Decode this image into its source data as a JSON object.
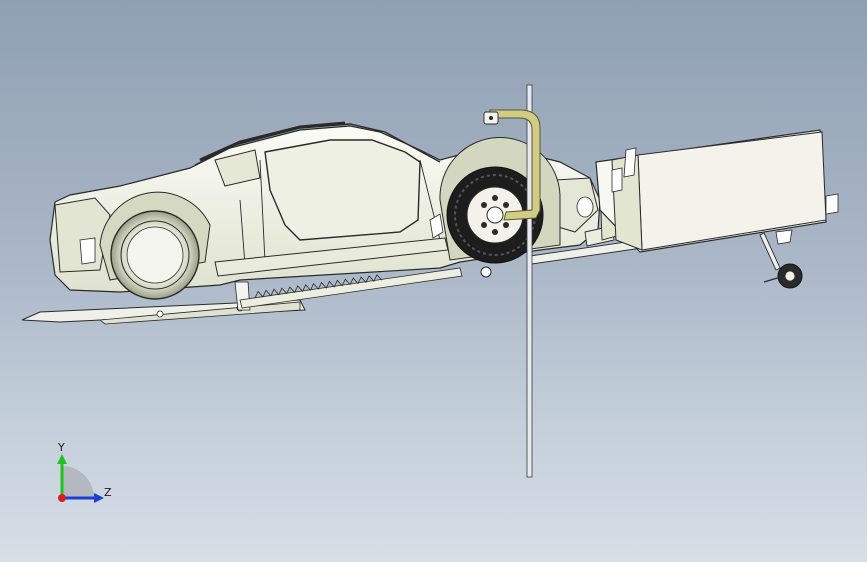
{
  "viewport": {
    "background_top": "#8fa0b3",
    "background_bottom": "#d6dee6"
  },
  "model": {
    "body_color": "#f4f4ee",
    "shade_color": "#d8dcc0",
    "line_color": "#2a2a2a",
    "rod_color": "#e9eaf0",
    "handle_color": "#c9c27a"
  },
  "triad": {
    "y_label": "Y",
    "z_label": "Z",
    "y_color": "#1fc21f",
    "z_color": "#1f3fd6",
    "x_color": "#d42020"
  }
}
